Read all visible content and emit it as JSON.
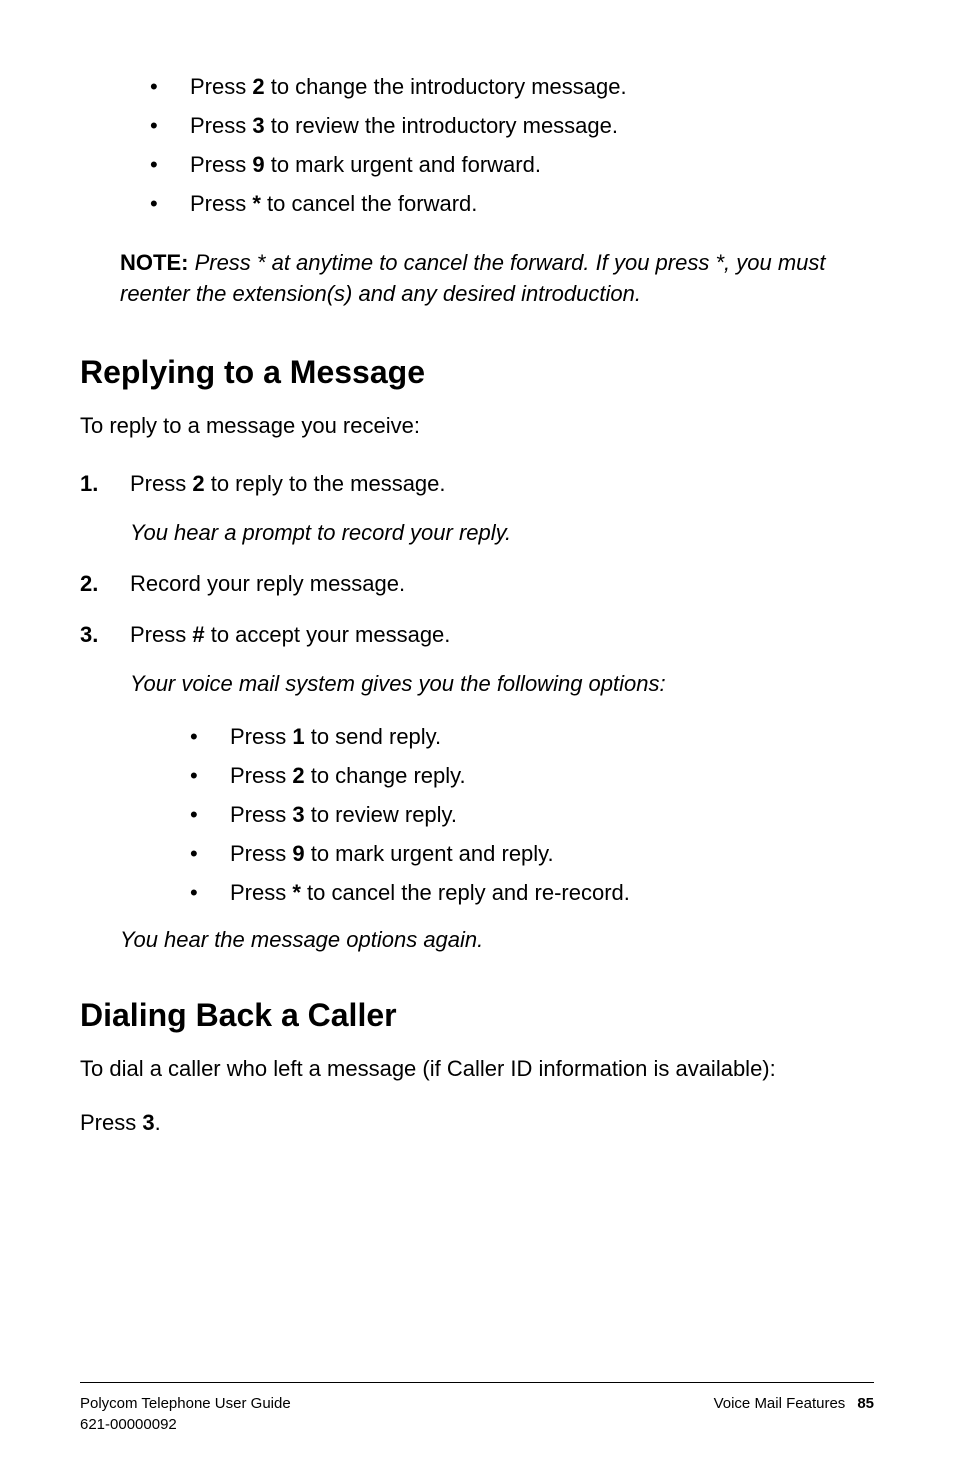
{
  "top_bullets": [
    {
      "prefix": "Press ",
      "key": "2",
      "suffix": " to change the introductory message."
    },
    {
      "prefix": "Press ",
      "key": "3",
      "suffix": " to review the introductory message."
    },
    {
      "prefix": "Press ",
      "key": "9",
      "suffix": " to mark urgent and forward."
    },
    {
      "prefix": "Press ",
      "key": "*",
      "suffix": " to cancel the forward."
    }
  ],
  "note": {
    "label": "NOTE:",
    "body": " Press * at anytime to cancel the forward. If you press *, you must reenter the extension(s) and any desired introduction."
  },
  "section1": {
    "heading": "Replying to a Message",
    "intro": "To reply to a message you receive:",
    "steps": [
      {
        "num": "1.",
        "prefix": "Press ",
        "key": "2",
        "suffix": " to reply to the message.",
        "italic": "You hear a prompt to record your reply."
      },
      {
        "num": "2.",
        "text": "Record your reply message."
      },
      {
        "num": "3.",
        "prefix": "Press ",
        "key": "#",
        "suffix": " to accept your message.",
        "italic": "Your voice mail system gives you the following options:"
      }
    ],
    "inner_bullets": [
      {
        "prefix": "Press ",
        "key": "1",
        "suffix": " to send reply."
      },
      {
        "prefix": "Press ",
        "key": "2",
        "suffix": " to change reply."
      },
      {
        "prefix": "Press ",
        "key": "3",
        "suffix": " to review reply."
      },
      {
        "prefix": "Press ",
        "key": "9",
        "suffix": " to mark urgent and reply."
      },
      {
        "prefix": "Press ",
        "key": "*",
        "suffix": " to cancel the reply and re-record."
      }
    ],
    "after_italic": "You hear the message options again."
  },
  "section2": {
    "heading": "Dialing Back a Caller",
    "intro": "To dial a caller who left a message (if Caller ID information is available):",
    "body_prefix": "Press ",
    "body_key": "3",
    "body_suffix": "."
  },
  "footer": {
    "left_line1": "Polycom Telephone User Guide",
    "left_line2": "621-00000092",
    "right_text": "Voice Mail Features",
    "page": "85"
  }
}
